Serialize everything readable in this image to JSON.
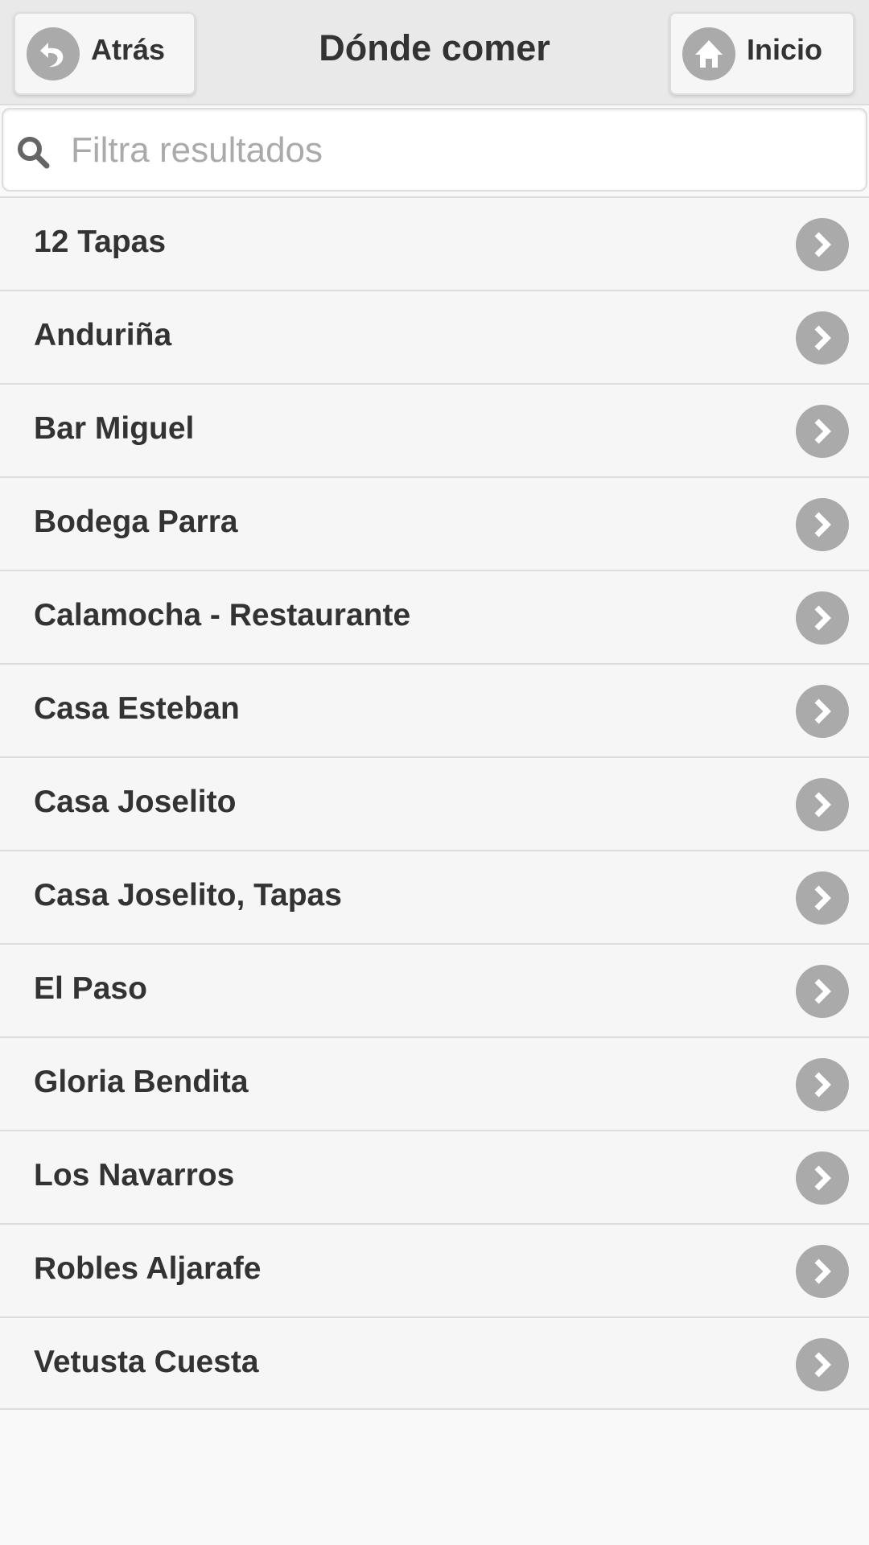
{
  "header": {
    "title": "Dónde comer",
    "back_label": "Atrás",
    "home_label": "Inicio"
  },
  "search": {
    "placeholder": "Filtra resultados",
    "value": ""
  },
  "list": {
    "items": [
      {
        "label": "12 Tapas"
      },
      {
        "label": "Anduriña"
      },
      {
        "label": "Bar Miguel"
      },
      {
        "label": "Bodega Parra"
      },
      {
        "label": "Calamocha - Restaurante"
      },
      {
        "label": "Casa Esteban"
      },
      {
        "label": "Casa Joselito"
      },
      {
        "label": "Casa Joselito, Tapas"
      },
      {
        "label": "El Paso"
      },
      {
        "label": "Gloria Bendita"
      },
      {
        "label": "Los Navarros"
      },
      {
        "label": "Robles Aljarafe"
      },
      {
        "label": "Vetusta Cuesta"
      }
    ]
  },
  "icons": {
    "back": "back-arrow-icon",
    "home": "home-icon",
    "search": "search-icon",
    "chevron": "chevron-right-icon"
  },
  "colors": {
    "header_bg": "#e9e9e9",
    "icon_bg": "#aaaaaa",
    "row_bg": "#f6f6f6"
  }
}
